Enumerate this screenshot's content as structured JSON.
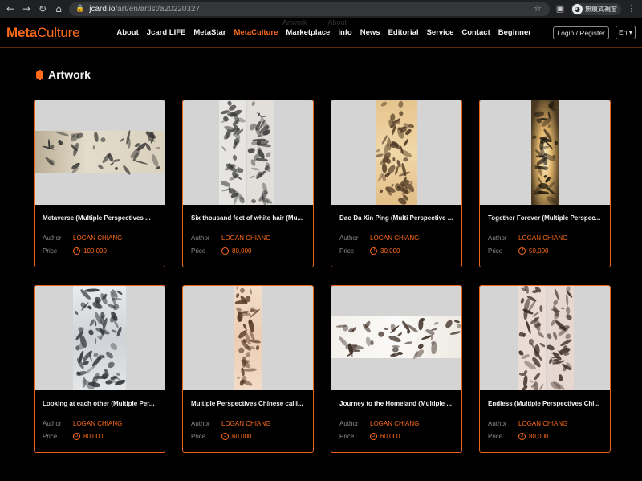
{
  "browser": {
    "url_host": "jcard.io",
    "url_path": "/art/en/artist/a20220327",
    "profile_label": "無痕式視窗"
  },
  "site": {
    "logo_bold": "Meta",
    "logo_light": "Culture",
    "ghost_nav": [
      "Artwork",
      "About"
    ],
    "menu": [
      {
        "label": "About",
        "active": false
      },
      {
        "label": "Jcard LIFE",
        "active": false
      },
      {
        "label": "MetaStar",
        "active": false
      },
      {
        "label": "MetaCulture",
        "active": true
      },
      {
        "label": "Marketplace",
        "active": false
      },
      {
        "label": "Info",
        "active": false
      },
      {
        "label": "News",
        "active": false
      },
      {
        "label": "Editorial",
        "active": false
      },
      {
        "label": "Service",
        "active": false
      },
      {
        "label": "Contact",
        "active": false
      },
      {
        "label": "Beginner",
        "active": false
      }
    ],
    "login_label": "Login / Register",
    "lang_label": "En ▾",
    "accent_color": "#ff6b1a"
  },
  "section": {
    "title": "Artwork"
  },
  "labels": {
    "author": "Author",
    "price": "Price"
  },
  "artworks": [
    {
      "title": "Metaverse (Multiple Perspectives ...",
      "author": "LOGAN CHIANG",
      "price": "100,000",
      "style": "wide-cream"
    },
    {
      "title": "Six thousand feet of white hair (Mu...",
      "author": "LOGAN CHIANG",
      "price": "80,000",
      "style": "tall-grey-double"
    },
    {
      "title": "Dao Da Xin Ping (Multi Perspective ...",
      "author": "LOGAN CHIANG",
      "price": "30,000",
      "style": "tall-gold"
    },
    {
      "title": "Together Forever (Multiple Perspec...",
      "author": "LOGAN CHIANG",
      "price": "50,000",
      "style": "tall-glow"
    },
    {
      "title": "Looking at each other (Multiple Per...",
      "author": "LOGAN CHIANG",
      "price": "80,000",
      "style": "tall-silver"
    },
    {
      "title": "Multiple Perspectives Chinese calli...",
      "author": "LOGAN CHIANG",
      "price": "60,000",
      "style": "tall-peach"
    },
    {
      "title": "Journey to the Homeland (Multiple ...",
      "author": "LOGAN CHIANG",
      "price": "60,000",
      "style": "wide-white"
    },
    {
      "title": "Endless (Multiple Perspectives Chi...",
      "author": "LOGAN CHIANG",
      "price": "80,000",
      "style": "tall-rose-double"
    }
  ]
}
